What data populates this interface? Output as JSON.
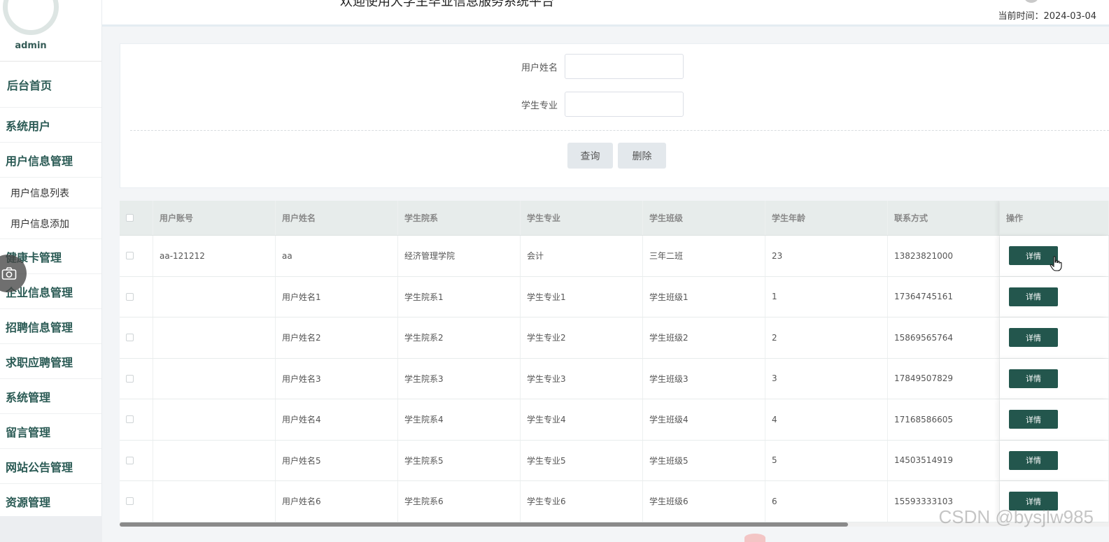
{
  "header": {
    "title": "欢迎使用大学生毕业信息服务系统平台",
    "current_time": "当前时间：2024-03-04"
  },
  "sidebar": {
    "admin_name": "admin",
    "items": [
      {
        "label": "后台首页"
      },
      {
        "label": "系统用户"
      },
      {
        "label": "用户信息管理"
      },
      {
        "label": "用户信息列表"
      },
      {
        "label": "用户信息添加"
      },
      {
        "label": "健康卡管理"
      },
      {
        "label": "企业信息管理"
      },
      {
        "label": "招聘信息管理"
      },
      {
        "label": "求职应聘管理"
      },
      {
        "label": "系统管理"
      },
      {
        "label": "留言管理"
      },
      {
        "label": "网站公告管理"
      },
      {
        "label": "资源管理"
      }
    ]
  },
  "search": {
    "name_label": "用户姓名",
    "name_value": "",
    "major_label": "学生专业",
    "major_value": "",
    "query_button": "查询",
    "delete_button": "删除"
  },
  "table": {
    "headers": [
      "用户账号",
      "用户姓名",
      "学生院系",
      "学生专业",
      "学生班级",
      "学生年龄",
      "联系方式",
      "操作"
    ],
    "detail_label": "详情",
    "rows": [
      {
        "account": "aa-121212",
        "name": "aa",
        "dept": "经济管理学院",
        "major": "会计",
        "cls": "三年二班",
        "age": "23",
        "phone": "13823821000"
      },
      {
        "account": "",
        "name": "用户姓名1",
        "dept": "学生院系1",
        "major": "学生专业1",
        "cls": "学生班级1",
        "age": "1",
        "phone": "17364745161"
      },
      {
        "account": "",
        "name": "用户姓名2",
        "dept": "学生院系2",
        "major": "学生专业2",
        "cls": "学生班级2",
        "age": "2",
        "phone": "15869565764"
      },
      {
        "account": "",
        "name": "用户姓名3",
        "dept": "学生院系3",
        "major": "学生专业3",
        "cls": "学生班级3",
        "age": "3",
        "phone": "17849507829"
      },
      {
        "account": "",
        "name": "用户姓名4",
        "dept": "学生院系4",
        "major": "学生专业4",
        "cls": "学生班级4",
        "age": "4",
        "phone": "17168586605"
      },
      {
        "account": "",
        "name": "用户姓名5",
        "dept": "学生院系5",
        "major": "学生专业5",
        "cls": "学生班级5",
        "age": "5",
        "phone": "14503514919"
      },
      {
        "account": "",
        "name": "用户姓名6",
        "dept": "学生院系6",
        "major": "学生专业6",
        "cls": "学生班级6",
        "age": "6",
        "phone": "15593333103"
      }
    ]
  },
  "watermark": "CSDN @bysjlw985",
  "colors": {
    "primary": "#23564d",
    "menu_text": "#2a5a54",
    "table_header_bg": "#e7eceb"
  },
  "icons": [
    "camera-icon",
    "hand-pointer-icon"
  ]
}
